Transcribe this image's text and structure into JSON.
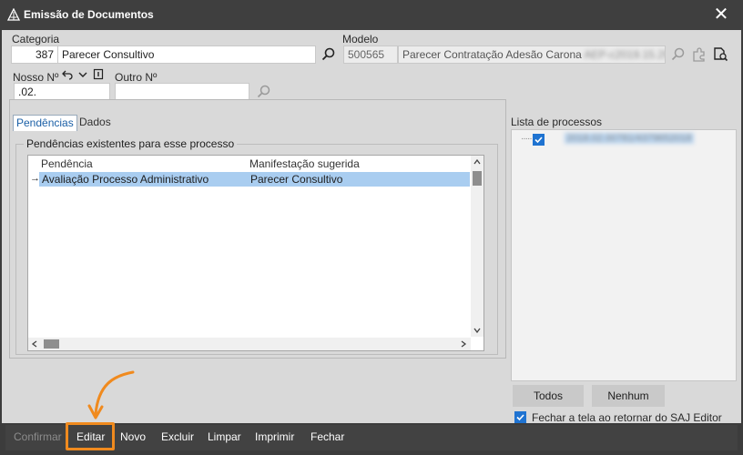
{
  "window": {
    "title": "Emissão de Documentos",
    "close_glyph": "✕"
  },
  "form": {
    "categoria_label": "Categoria",
    "categoria_code": "387",
    "categoria_name": "Parecer Consultivo",
    "modelo_label": "Modelo",
    "modelo_code": "500565",
    "modelo_name": "Parecer Contratação Adesão Carona",
    "modelo_suffix_blurred": "AEP-c2019.15.29",
    "nosso_label": "Nosso Nº",
    "nosso_value": ".02.",
    "outro_label": "Outro Nº",
    "outro_value": ""
  },
  "tabs": {
    "pendencias": "Pendências",
    "dados": "Dados"
  },
  "group": {
    "title": "Pendências existentes para esse processo"
  },
  "grid": {
    "columns": [
      "Pendência",
      "Manifestação sugerida"
    ],
    "rows": [
      {
        "pendencia": "Avaliação Processo Administrativo",
        "manifestacao": "Parecer Consultivo",
        "indicator": "→"
      }
    ]
  },
  "processos": {
    "label": "Lista de processos",
    "item_blurred": "2018.02.00781/4379652018"
  },
  "buttons": {
    "todos": "Todos",
    "nenhum": "Nenhum"
  },
  "options": {
    "fechar_label": "Fechar a tela ao retornar do SAJ Editor",
    "fechar_checked": true
  },
  "toolbar": {
    "confirmar": "Confirmar",
    "editar": "Editar",
    "novo": "Novo",
    "excluir": "Excluir",
    "limpar": "Limpar",
    "imprimir": "Imprimir",
    "fechar": "Fechar"
  },
  "colors": {
    "accent": "#1f73d1",
    "selection": "#a9cdf0",
    "annotation": "#f08a1e"
  }
}
